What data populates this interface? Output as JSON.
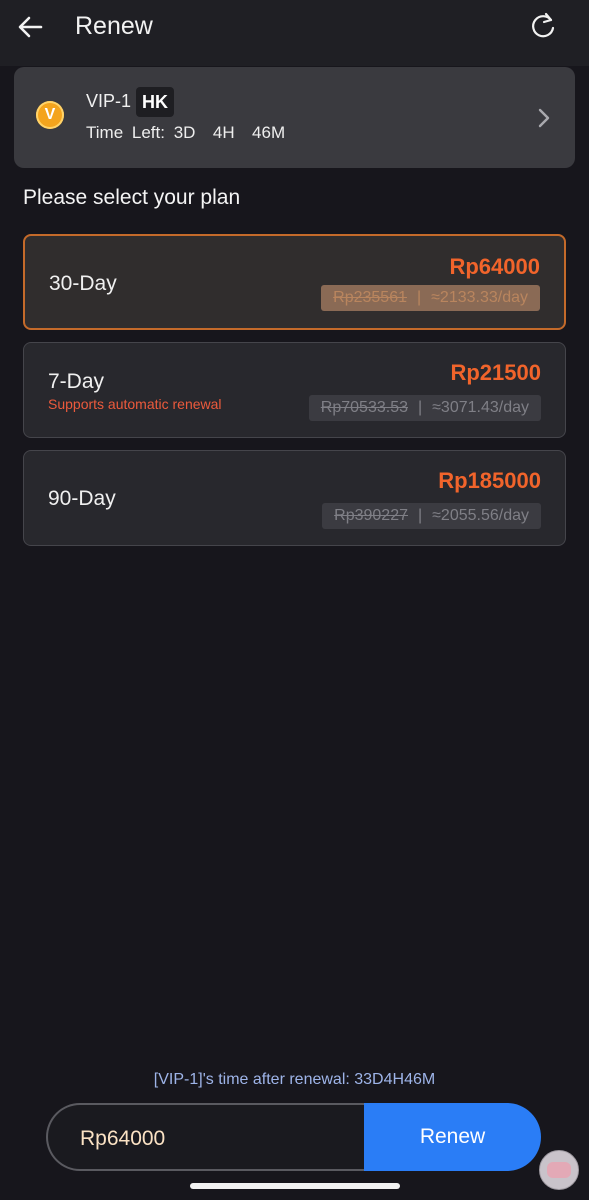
{
  "header": {
    "title": "Renew",
    "back_icon": "arrow-left-icon",
    "refresh_icon": "refresh-icon"
  },
  "vip": {
    "badge_letter": "V",
    "level": "VIP-1",
    "region": "HK",
    "time_left_label": "Time Left:",
    "time_left_value": "3D  4H  46M"
  },
  "section_title": "Please select your plan",
  "plans": [
    {
      "name": "30-Day",
      "price": "Rp64000",
      "original_price": "Rp235561",
      "per_day": "≈2133.33/day",
      "note": "",
      "selected": true
    },
    {
      "name": "7-Day",
      "price": "Rp21500",
      "original_price": "Rp70533.53",
      "per_day": "≈3071.43/day",
      "note": "Supports automatic renewal",
      "selected": false
    },
    {
      "name": "90-Day",
      "price": "Rp185000",
      "original_price": "Rp390227",
      "per_day": "≈2055.56/day",
      "note": "",
      "selected": false
    }
  ],
  "separator": "|",
  "renewal_note": "[VIP-1]'s time after renewal: 33D4H46M",
  "footer": {
    "total_price": "Rp64000",
    "renew_button": "Renew"
  },
  "colors": {
    "accent_orange": "#f1642b",
    "primary_blue": "#2a7df6",
    "background": "#17161c"
  }
}
